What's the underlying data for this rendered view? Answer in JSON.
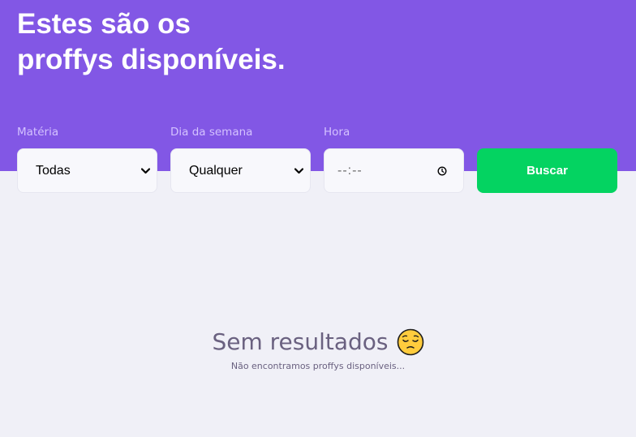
{
  "header": {
    "title_line1": "Estes são os",
    "title_line2": "proffys disponíveis."
  },
  "filters": {
    "subject": {
      "label": "Matéria",
      "value": "Todas"
    },
    "weekday": {
      "label": "Dia da semana",
      "value": "Qualquer"
    },
    "time": {
      "label": "Hora",
      "value": "--:--"
    },
    "search_label": "Buscar"
  },
  "empty": {
    "title": "Sem resultados",
    "subtitle": "Não encontramos proffys disponíveis...",
    "icon": "pensive-face-icon"
  },
  "colors": {
    "primary": "#8257e5",
    "secondary": "#04d361",
    "background": "#f0f0f7",
    "label": "#d4c2ff",
    "text_muted": "#6a6180"
  }
}
